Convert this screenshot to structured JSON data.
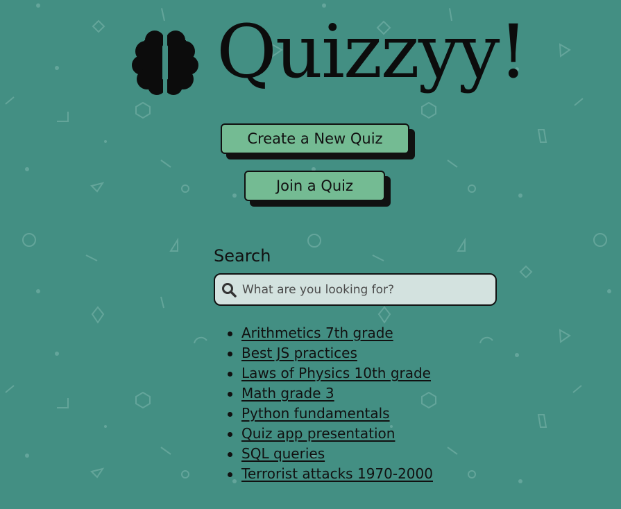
{
  "app": {
    "title": "Quizzyy!"
  },
  "icons": {
    "logo": "brain-icon",
    "search": "search-icon"
  },
  "colors": {
    "background": "#438f83",
    "button": "#74bb93",
    "button_shadow": "#111111",
    "search_field": "#d3e2df",
    "text": "#111111"
  },
  "actions": {
    "create_quiz": "Create a New Quiz",
    "join_quiz": "Join a Quiz"
  },
  "search": {
    "label": "Search",
    "placeholder": "What are you looking for?",
    "value": ""
  },
  "quizzes": [
    "Arithmetics 7th grade",
    "Best JS practices",
    "Laws of Physics 10th grade",
    "Math grade 3",
    "Python fundamentals",
    "Quiz app presentation",
    "SQL queries",
    "Terrorist attacks 1970-2000"
  ]
}
